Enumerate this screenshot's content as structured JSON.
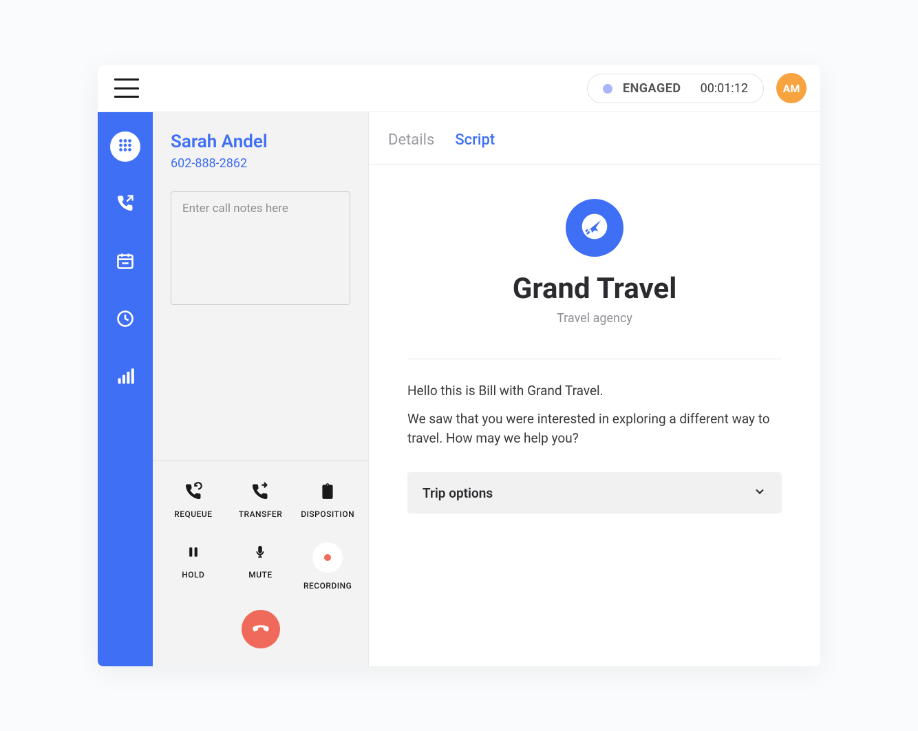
{
  "colors": {
    "accent": "#3f6ff5",
    "avatar": "#f7a340",
    "danger": "#f06a5b",
    "status_dot": "#aab6fa"
  },
  "header": {
    "status_label": "ENGAGED",
    "timer": "00:01:12",
    "avatar_initials": "AM"
  },
  "nav": {
    "items": [
      {
        "name": "dialpad-icon",
        "active": true
      },
      {
        "name": "outbound-call-icon",
        "active": false
      },
      {
        "name": "calendar-icon",
        "active": false
      },
      {
        "name": "clock-icon",
        "active": false
      },
      {
        "name": "stats-icon",
        "active": false
      }
    ]
  },
  "call": {
    "contact_name": "Sarah Andel",
    "contact_phone": "602-888-2862",
    "notes_placeholder": "Enter call notes here",
    "actions": {
      "requeue": "REQUEUE",
      "transfer": "TRANSFER",
      "disposition": "DISPOSITION",
      "hold": "HOLD",
      "mute": "MUTE",
      "recording": "RECORDING"
    }
  },
  "main": {
    "tabs": {
      "details": "Details",
      "script": "Script",
      "active": "script"
    },
    "org": {
      "name": "Grand Travel",
      "type": "Travel agency"
    },
    "script_lines": [
      "Hello this is Bill with Grand Travel.",
      "We saw that you were interested in exploring a different way to travel. How may we help you?"
    ],
    "dropdown_label": "Trip options"
  }
}
